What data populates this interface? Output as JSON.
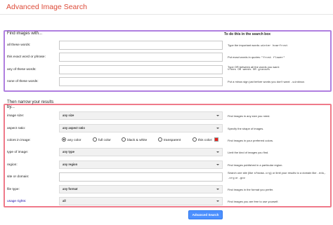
{
  "page": {
    "title": "Advanced Image Search"
  },
  "find": {
    "heading": "Find images with...",
    "do_heading": "To do this in the search box",
    "rows": [
      {
        "label": "all these words:",
        "value": "",
        "tip_prefix": "Type the important words: ",
        "tip_code": "winter hoarfrost",
        "tip_suffix": ""
      },
      {
        "label": "this exact word or phrase:",
        "value": "",
        "tip_prefix": "Put exact words in quotes: ",
        "tip_code": "\"frost flower\"",
        "tip_suffix": ""
      },
      {
        "label": "any of these words:",
        "value": "",
        "tip_prefix": "Type OR between all the words you want:",
        "tip_code": "trees OR weeds OR grasses",
        "tip_suffix": ""
      },
      {
        "label": "none of these words:",
        "value": "",
        "tip_prefix": "Put a minus sign just before words you don't want: ",
        "tip_code": "-windows",
        "tip_suffix": ""
      }
    ]
  },
  "narrow": {
    "heading_line1": "Then narrow your results",
    "heading_line2": "by...",
    "image_size": {
      "label": "image size:",
      "selected": "any size",
      "tip": "Find images in any size you need."
    },
    "aspect_ratio": {
      "label": "aspect ratio:",
      "selected": "any aspect ratio",
      "tip": "Specify the shape of images."
    },
    "colors": {
      "label": "colors in image:",
      "options": [
        "any color",
        "full color",
        "black & white",
        "transparent",
        "this color:"
      ],
      "selected_index": 0,
      "swatch_color": "#e8221c",
      "tip": "Find images in your preferred colors."
    },
    "type": {
      "label": "type of image:",
      "selected": "any type",
      "tip": "Limit the kind of images you find."
    },
    "region": {
      "label": "region:",
      "selected": "any region",
      "tip": "Find images published in a particular region."
    },
    "site": {
      "label": "site or domain:",
      "value": "",
      "tip_1": "Search one site (like ",
      "tip_code_1": "sfmoma.org",
      "tip_2": ") or limit your results to a domain like ",
      "tip_code_2": ".edu, .org",
      "tip_3": " or ",
      "tip_code_3": ".gov"
    },
    "file_type": {
      "label": "file type:",
      "selected": "any format",
      "tip": "Find images in the format you prefer."
    },
    "usage": {
      "label": "usage rights:",
      "selected": "all",
      "tip": "Find images you are free to use yourself."
    }
  },
  "actions": {
    "submit_label": "Advanced Search"
  },
  "colors": {
    "title": "#dd4b39",
    "find_border": "#b07fe0",
    "narrow_border": "#ef7a8a",
    "button": "#4d90fe",
    "link": "#1a0dab"
  }
}
